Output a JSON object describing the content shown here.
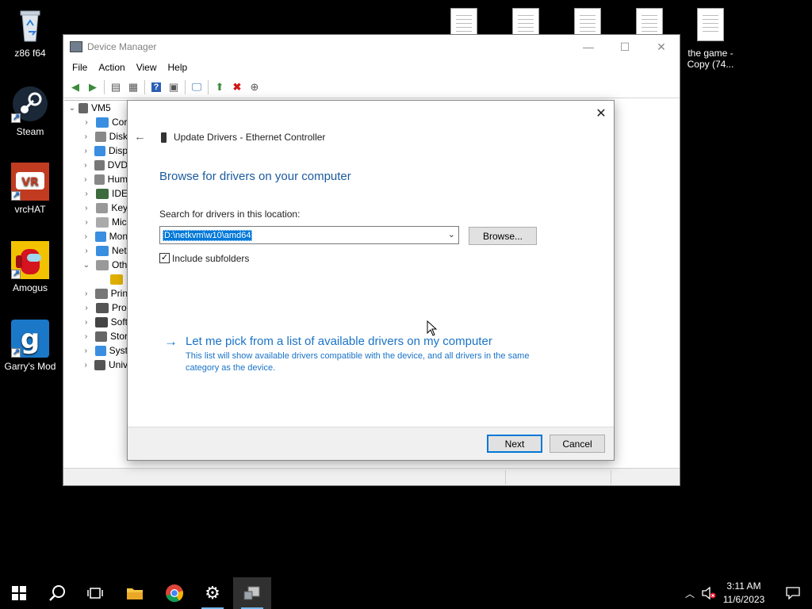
{
  "desktop": {
    "icons_left": [
      {
        "label": "z86 f64",
        "icon": "recycle-bin-icon"
      },
      {
        "label": "Steam",
        "icon": "steam-icon"
      },
      {
        "label": "vrcHAT",
        "icon": "vrchat-icon"
      },
      {
        "label": "Amogus",
        "icon": "among-us-icon"
      },
      {
        "label": "Garry's Mod",
        "icon": "garrys-mod-icon"
      }
    ],
    "icons_top": [
      {
        "label": "",
        "icon": "document-icon"
      },
      {
        "label": "",
        "icon": "document-icon"
      },
      {
        "label": "",
        "icon": "document-icon"
      },
      {
        "label": "",
        "icon": "document-icon"
      },
      {
        "label": "the game - Copy (74...",
        "icon": "document-icon"
      }
    ],
    "logos": {
      "vrchat": "VR",
      "gmod": "g"
    }
  },
  "device_manager": {
    "title": "Device Manager",
    "menu": [
      "File",
      "Action",
      "View",
      "Help"
    ],
    "toolbar_icons": [
      "back-icon",
      "forward-icon",
      "properties-icon",
      "device-list-icon",
      "help-icon",
      "view-icon",
      "scan-hardware-icon",
      "update-driver-icon",
      "uninstall-icon",
      "disable-icon"
    ],
    "tree": {
      "root": "VM5",
      "items": [
        {
          "label": "Cor",
          "expanded": false,
          "color": "#3a8ee0"
        },
        {
          "label": "Disk",
          "expanded": false,
          "color": "#888888"
        },
        {
          "label": "Disp",
          "expanded": false,
          "color": "#3a8ee0"
        },
        {
          "label": "DVD",
          "expanded": false,
          "color": "#777777"
        },
        {
          "label": "Hum",
          "expanded": false,
          "color": "#888888"
        },
        {
          "label": "IDE",
          "expanded": false,
          "color": "#3d6b3d"
        },
        {
          "label": "Key",
          "expanded": false,
          "color": "#999999"
        },
        {
          "label": "Mic",
          "expanded": false,
          "color": "#aaaaaa"
        },
        {
          "label": "Mon",
          "expanded": false,
          "color": "#3a8ee0"
        },
        {
          "label": "Net",
          "expanded": false,
          "color": "#3a8ee0"
        },
        {
          "label": "Oth",
          "expanded": true,
          "color": "#999999"
        },
        {
          "label": "",
          "expanded": null,
          "color": "#e0b000",
          "child": true
        },
        {
          "label": "Prin",
          "expanded": false,
          "color": "#777777"
        },
        {
          "label": "Pro",
          "expanded": false,
          "color": "#555555"
        },
        {
          "label": "Soft",
          "expanded": false,
          "color": "#444444"
        },
        {
          "label": "Stor",
          "expanded": false,
          "color": "#666666"
        },
        {
          "label": "Syst",
          "expanded": false,
          "color": "#3a8ee0"
        },
        {
          "label": "Univ",
          "expanded": false,
          "color": "#555555"
        }
      ]
    }
  },
  "dialog": {
    "header": "Update Drivers - Ethernet Controller",
    "heading": "Browse for drivers on your computer",
    "location_label": "Search for drivers in this location:",
    "path_value": "D:\\netkvm\\w10\\amd64",
    "browse_label": "Browse...",
    "include_subfolders_label": "Include subfolders",
    "include_subfolders_checked": true,
    "pick_link": "Let me pick from a list of available drivers on my computer",
    "pick_desc": "This list will show available drivers compatible with the device, and all drivers in the same category as the device.",
    "next_label": "Next",
    "cancel_label": "Cancel",
    "accent_color": "#1a73c7"
  },
  "taskbar": {
    "items": [
      "start-icon",
      "search-icon",
      "task-view-icon",
      "file-explorer-icon",
      "chrome-icon",
      "settings-icon",
      "device-manager-icon"
    ],
    "tray": [
      "show-hidden-icons-icon",
      "volume-muted-icon",
      "notification-icon"
    ],
    "time": "3:11 AM",
    "date": "11/6/2023"
  }
}
